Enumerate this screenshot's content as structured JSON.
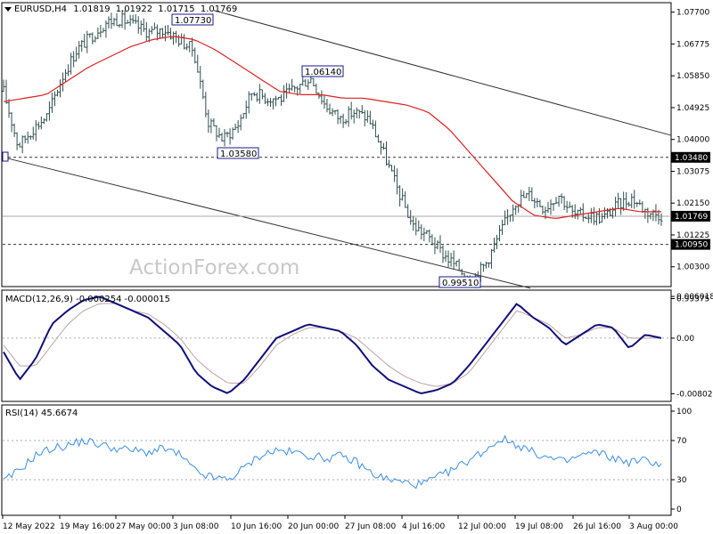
{
  "header": {
    "symbol": "EURUSD,H4",
    "open": "1.01819",
    "high": "1.01922",
    "low": "1.01715",
    "close": "1.01769"
  },
  "watermark": "ActionForex.com",
  "colors": {
    "bars": "#2f4f4f",
    "ma": "#e02020",
    "macd": "#10107a",
    "signal": "#c0a0a0",
    "rsi": "#3a8ee6",
    "trend": "#333333",
    "grid": "#aaaaaa"
  },
  "chart_data": [
    {
      "type": "line",
      "title": "EURUSD,H4",
      "ylim": [
        0.9975,
        1.0795
      ],
      "yticks": [
        "1.07700",
        "1.06775",
        "1.05850",
        "1.04925",
        "1.04000",
        "1.03075",
        "1.02150",
        "1.01225",
        "1.00300",
        "0.99375"
      ],
      "x_labels": [
        "12 May 2022",
        "19 May 16:00",
        "27 May 00:00",
        "3 Jun 08:00",
        "10 Jun 16:00",
        "20 Jun 00:00",
        "27 Jun 08:00",
        "4 Jul 16:00",
        "12 Jul 00:00",
        "19 Jul 08:00",
        "26 Jul 16:00",
        "3 Aug 00:00"
      ],
      "levels": {
        "resistance": "1.03480",
        "support": "1.00950",
        "current": "1.01769"
      },
      "annotations": [
        "1.07730",
        "1.03580",
        "1.06140",
        "0.99510"
      ],
      "series": [
        {
          "kind": "price-close",
          "values": [
            1.054,
            1.038,
            1.043,
            1.047,
            1.058,
            1.066,
            1.07,
            1.074,
            1.075,
            1.073,
            1.071,
            1.072,
            1.069,
            1.066,
            1.045,
            1.04,
            1.044,
            1.054,
            1.052,
            1.052,
            1.055,
            1.058,
            1.05,
            1.046,
            1.048,
            1.046,
            1.036,
            1.025,
            1.015,
            1.012,
            1.007,
            1.003,
            0.999,
            1.004,
            1.013,
            1.022,
            1.024,
            1.02,
            1.024,
            1.018,
            1.018,
            1.017,
            1.021,
            1.023,
            1.019,
            1.018
          ]
        },
        {
          "kind": "moving-average",
          "values": [
            1.051,
            1.052,
            1.053,
            1.057,
            1.061,
            1.064,
            1.067,
            1.069,
            1.07,
            1.069,
            1.066,
            1.062,
            1.058,
            1.054,
            1.053,
            1.053,
            1.052,
            1.052,
            1.051,
            1.05,
            1.048,
            1.043,
            1.036,
            1.029,
            1.022,
            1.018,
            1.017,
            1.018,
            1.019,
            1.02,
            1.019,
            1.019
          ]
        }
      ]
    },
    {
      "type": "line",
      "title": "MACD(12,26,9) -0.000254 -0.000015",
      "ylim": [
        -0.009,
        0.0068
      ],
      "yticks": [
        "0.006018",
        "0.00",
        "-0.00802"
      ],
      "series": [
        {
          "name": "MACD",
          "values": [
            -0.002,
            -0.006,
            -0.003,
            0.002,
            0.004,
            0.0055,
            0.006,
            0.005,
            0.004,
            0.003,
            0.001,
            -0.001,
            -0.005,
            -0.007,
            -0.008,
            -0.006,
            -0.003,
            0.0,
            0.001,
            0.002,
            0.0015,
            0.001,
            -0.001,
            -0.004,
            -0.006,
            -0.007,
            -0.008,
            -0.0075,
            -0.0065,
            -0.004,
            -0.001,
            0.002,
            0.005,
            0.003,
            0.0015,
            -0.001,
            0.0005,
            0.002,
            0.0015,
            -0.0015,
            0.0005,
            0.0
          ]
        },
        {
          "name": "Signal",
          "values": [
            -0.001,
            -0.004,
            -0.004,
            -0.001,
            0.002,
            0.004,
            0.005,
            0.005,
            0.004,
            0.0035,
            0.002,
            0.0,
            -0.003,
            -0.005,
            -0.0065,
            -0.0065,
            -0.004,
            -0.001,
            0.0005,
            0.0015,
            0.0015,
            0.001,
            0.0,
            -0.002,
            -0.004,
            -0.0055,
            -0.0065,
            -0.007,
            -0.0065,
            -0.005,
            -0.002,
            0.001,
            0.004,
            0.003,
            0.002,
            0.0,
            0.0005,
            0.0015,
            0.0015,
            0.0,
            0.0,
            0.0
          ]
        }
      ]
    },
    {
      "type": "line",
      "title": "RSI(14) 45.6674",
      "ylim": [
        0,
        100
      ],
      "yticks": [
        "100",
        "70",
        "30",
        "0"
      ],
      "series": [
        {
          "name": "RSI",
          "values": [
            28,
            40,
            55,
            62,
            65,
            70,
            66,
            62,
            60,
            58,
            62,
            55,
            38,
            32,
            30,
            42,
            55,
            60,
            58,
            55,
            52,
            54,
            48,
            36,
            30,
            27,
            25,
            32,
            40,
            50,
            60,
            72,
            66,
            58,
            52,
            48,
            55,
            58,
            52,
            48,
            50,
            46
          ]
        }
      ]
    }
  ]
}
